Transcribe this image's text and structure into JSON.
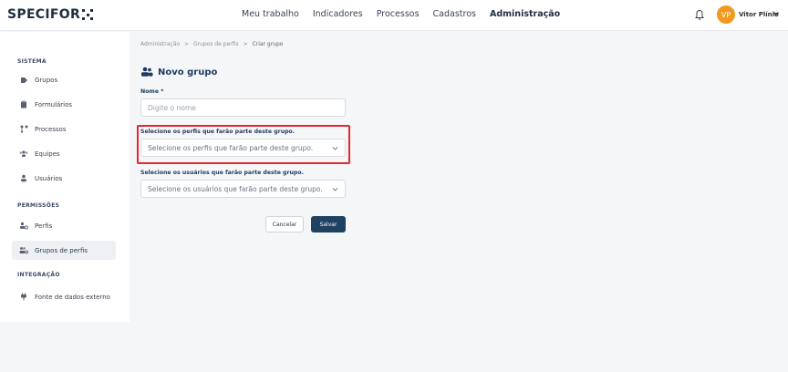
{
  "app": {
    "logo_text": "SPECIFOR",
    "colors": {
      "accent": "#1f4262",
      "highlight": "#e1262d",
      "avatar_bg": "#f29a1f"
    }
  },
  "nav": {
    "items": [
      "Meu trabalho",
      "Indicadores",
      "Processos",
      "Cadastros",
      "Administração"
    ],
    "active": "Administração"
  },
  "user": {
    "initials": "VP",
    "name": "Vitor Plínio"
  },
  "sidebar": {
    "sections": [
      {
        "title": "SISTEMA",
        "items": [
          "Grupos",
          "Formulários",
          "Processos",
          "Equipes",
          "Usuários"
        ]
      },
      {
        "title": "PERMISSÕES",
        "items": [
          "Perfis",
          "Grupos de perfis"
        ]
      },
      {
        "title": "INTEGRAÇÃO",
        "items": [
          "Fonte de dados externo"
        ]
      }
    ],
    "active_item": "Grupos de perfis"
  },
  "breadcrumb": {
    "items": [
      "Administração",
      "Grupos de perfis",
      "Criar grupo"
    ],
    "separator": ">"
  },
  "page": {
    "title": "Novo grupo"
  },
  "form": {
    "name_label": "Nome *",
    "name_placeholder": "Digite o nome",
    "profiles_label": "Selecione os perfis que farão parte deste grupo.",
    "profiles_placeholder": "Selecione os perfis que farão parte deste grupo.",
    "users_label": "Selecione os usuários que farão parte deste grupo.",
    "users_placeholder": "Selecione os usuários que farão parte deste grupo.",
    "cancel_label": "Cancelar",
    "save_label": "Salvar"
  }
}
